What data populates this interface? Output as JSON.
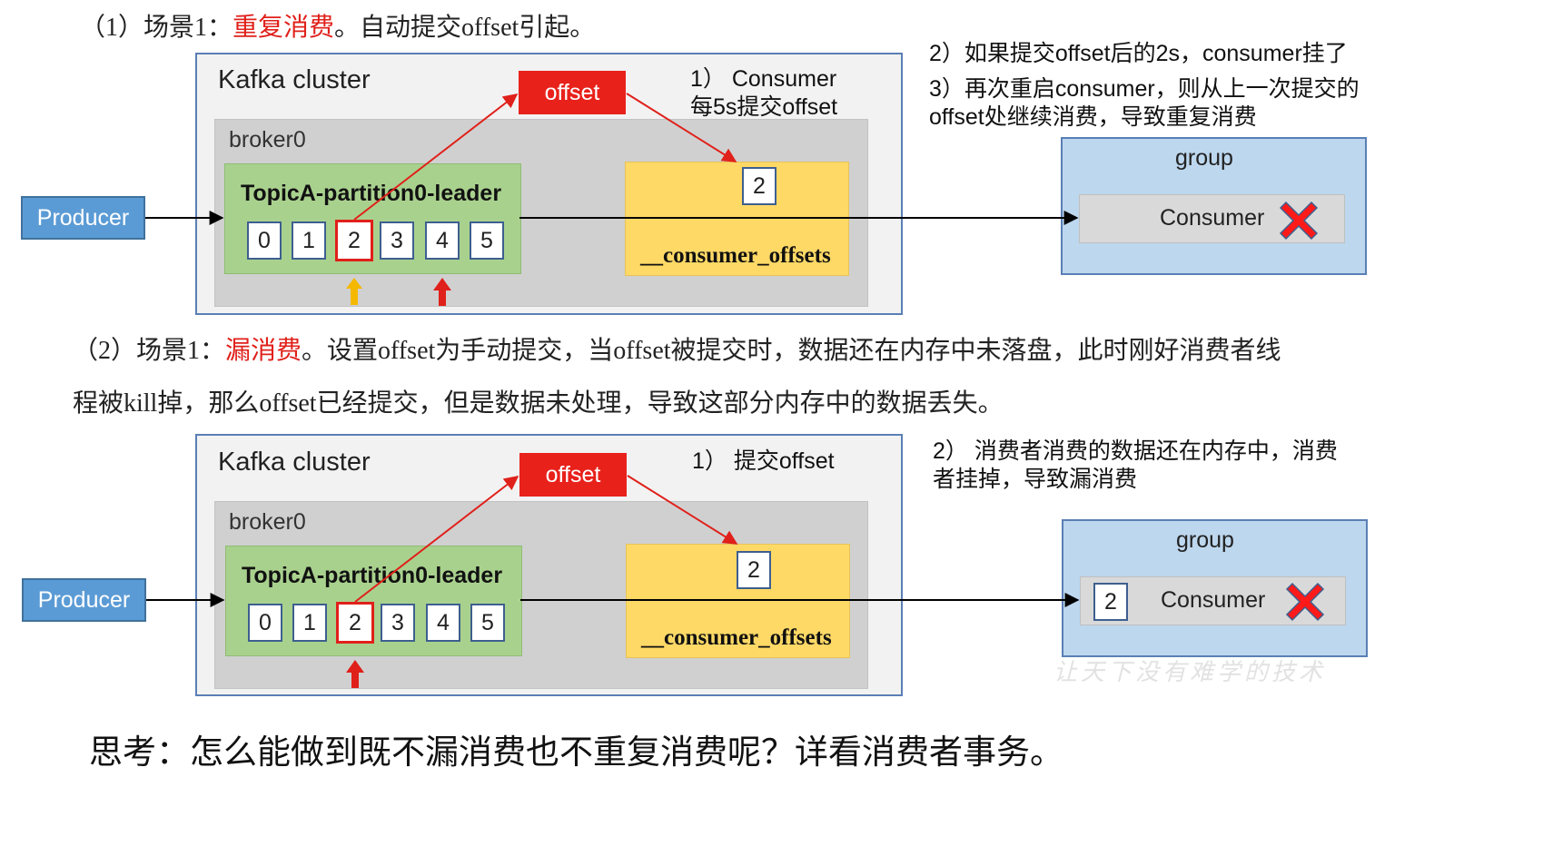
{
  "scenario1": {
    "prefix": "（1）场景1：",
    "highlight": "重复消费",
    "suffix": "。自动提交offset引起。",
    "diagram": {
      "cluster_title": "Kafka cluster",
      "broker_title": "broker0",
      "partition_title": "TopicA-partition0-leader",
      "cells": [
        "0",
        "1",
        "2",
        "3",
        "4",
        "5"
      ],
      "offset_label": "offset",
      "consumer_offsets_title": "__consumer_offsets",
      "stored_offset": "2",
      "producer_label": "Producer",
      "group_title": "group",
      "consumer_label": "Consumer",
      "step1_line1": "1）  Consumer",
      "step1_line2": "每5s提交offset",
      "note_lines": [
        "2）如果提交offset后的2s，consumer挂了",
        "3）再次重启consumer，则从上一次提交的",
        "offset处继续消费，导致重复消费"
      ],
      "arrow_colors": [
        "#f5b800",
        "#e0201a"
      ]
    }
  },
  "scenario2": {
    "prefix": "（2）场景1：",
    "highlight": "漏消费",
    "line1_suffix": "。设置offset为手动提交，当offset被提交时，数据还在内存中未落盘，此时刚好消费者线",
    "line2": "程被kill掉，那么offset已经提交，但是数据未处理，导致这部分内存中的数据丢失。",
    "diagram": {
      "cluster_title": "Kafka cluster",
      "broker_title": "broker0",
      "partition_title": "TopicA-partition0-leader",
      "cells": [
        "0",
        "1",
        "2",
        "3",
        "4",
        "5"
      ],
      "offset_label": "offset",
      "consumer_offsets_title": "__consumer_offsets",
      "stored_offset": "2",
      "producer_label": "Producer",
      "group_title": "group",
      "consumer_label": "Consumer",
      "consumer_offset": "2",
      "step1": "1）  提交offset",
      "note_lines": [
        "2）  消费者消费的数据还在内存中，消费",
        "者挂掉，导致漏消费"
      ],
      "arrow_colors": [
        "#e0201a"
      ]
    }
  },
  "watermark": "让天下没有难学的技术",
  "footer": "思考：怎么能做到既不漏消费也不重复消费呢？详看消费者事务。",
  "colors": {
    "accent_red": "#e0201a",
    "producer_blue": "#5b9bd5",
    "partition_green": "#a9d18e",
    "offsets_yellow": "#ffd966",
    "group_blue": "#bdd7ee"
  }
}
